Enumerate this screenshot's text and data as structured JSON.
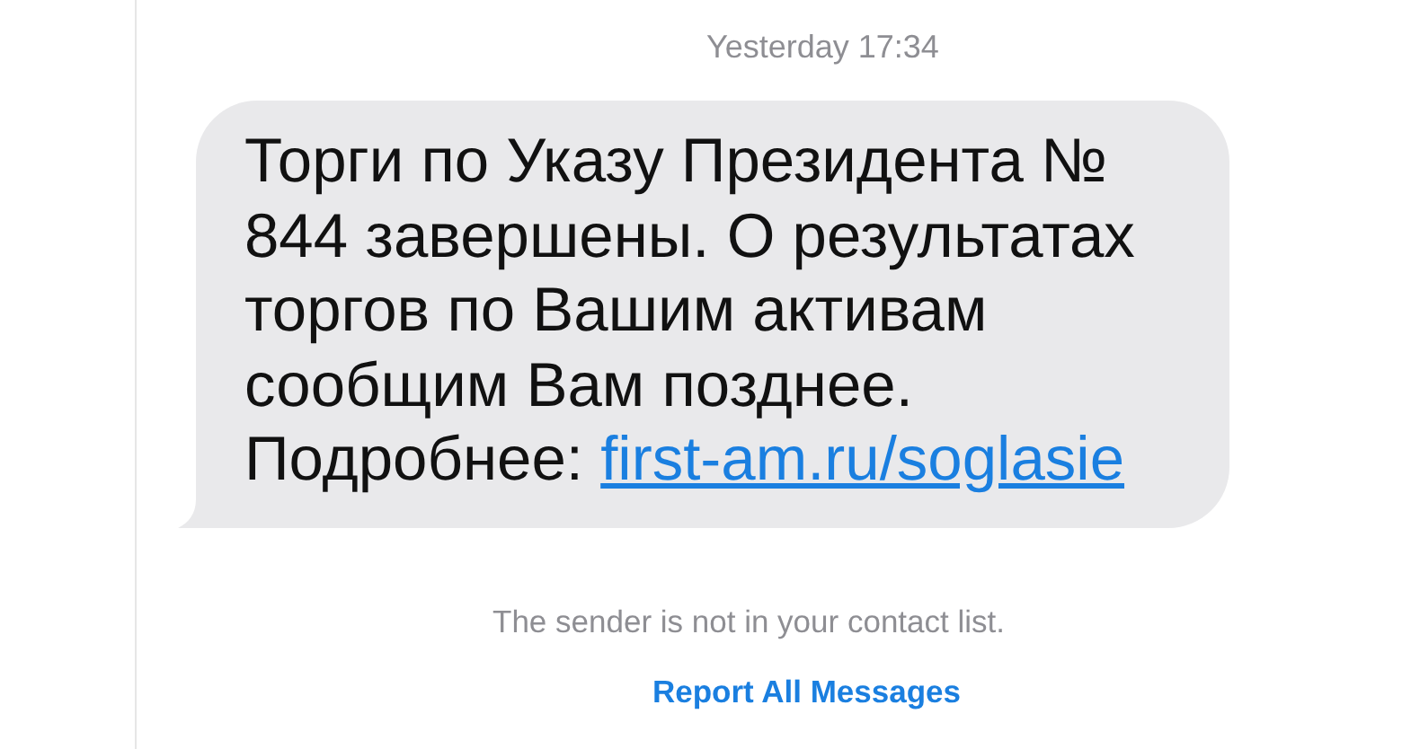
{
  "timestamp": "Yesterday 17:34",
  "message": {
    "text": "Торги по Указу Президента № 844 завершены. О результатах торгов по Вашим активам сообщим Вам позднее. Подробнее: ",
    "link": "first-am.ru/soglasie"
  },
  "notice": "The sender is not in your contact list.",
  "report_link": "Report All Messages"
}
